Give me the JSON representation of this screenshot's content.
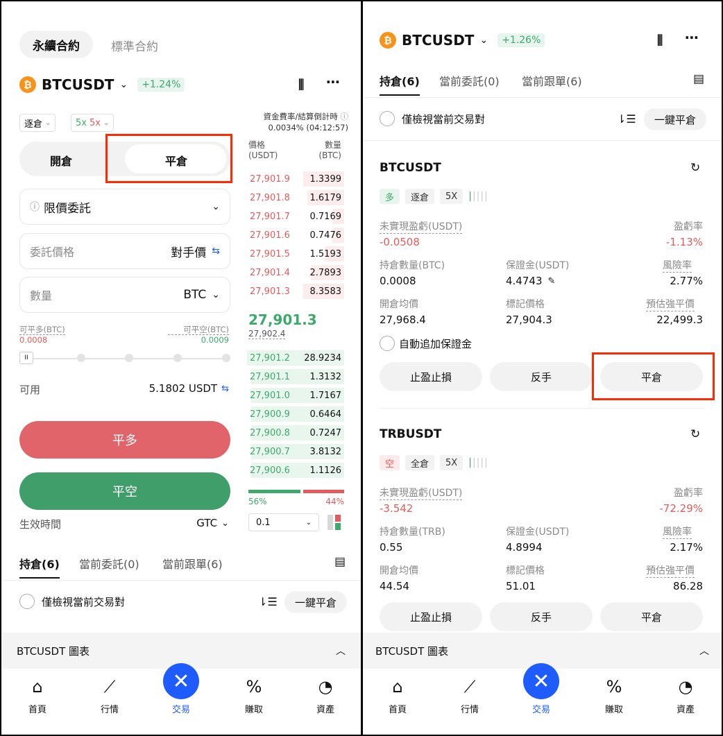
{
  "left": {
    "contract_tabs": [
      "永續合約",
      "標準合約"
    ],
    "symbol": "BTCUSDT",
    "change": "+1.24%",
    "margin_mode": "逐倉",
    "leverage_long": "5x",
    "leverage_short": "5x",
    "funding_label": "資金費率/結算倒計時",
    "funding_value": "0.0034% (04:12:57)",
    "open_close_tabs": [
      "開倉",
      "平倉"
    ],
    "order_type": "限價委託",
    "price_placeholder": "委託價格",
    "price_counter": "對手價",
    "qty_placeholder": "數量",
    "qty_unit": "BTC",
    "close_long_label": "可平多(BTC)",
    "close_long_value": "0.0008",
    "close_short_label": "可平空(BTC)",
    "close_short_value": "0.0009",
    "slider_handle": "II",
    "available_label": "可用",
    "available_value": "5.1802 USDT",
    "close_long_btn": "平多",
    "close_short_btn": "平空",
    "tif_label": "生效時間",
    "tif_value": "GTC",
    "ob_header_price": "價格",
    "ob_header_price_unit": "(USDT)",
    "ob_header_qty": "數量",
    "ob_header_qty_unit": "(BTC)",
    "asks": [
      {
        "p": "27,901.9",
        "q": "1.3399",
        "w": 0.42
      },
      {
        "p": "27,901.8",
        "q": "1.6179",
        "w": 0.38
      },
      {
        "p": "27,901.7",
        "q": "0.7169",
        "w": 0.12
      },
      {
        "p": "27,901.6",
        "q": "0.7476",
        "w": 0.12
      },
      {
        "p": "27,901.5",
        "q": "1.5193",
        "w": 0.2
      },
      {
        "p": "27,901.4",
        "q": "2.7893",
        "w": 0.34
      },
      {
        "p": "27,901.3",
        "q": "8.3583",
        "w": 0.42
      }
    ],
    "mid_price": "27,901.3",
    "mark_price": "27,902.4",
    "bids": [
      {
        "p": "27,901.2",
        "q": "28.9234",
        "w": 1.0
      },
      {
        "p": "27,901.1",
        "q": "1.3132",
        "w": 0.96
      },
      {
        "p": "27,901.0",
        "q": "1.7167",
        "w": 0.96
      },
      {
        "p": "27,900.9",
        "q": "0.6464",
        "w": 0.96
      },
      {
        "p": "27,900.8",
        "q": "0.7247",
        "w": 0.96
      },
      {
        "p": "27,900.7",
        "q": "3.8132",
        "w": 0.96
      },
      {
        "p": "27,900.6",
        "q": "1.1126",
        "w": 0.96
      }
    ],
    "buy_pct": "56%",
    "sell_pct": "44%",
    "buy_ratio": 0.56,
    "precision": "0.1",
    "bottom_tabs": [
      "持倉(6)",
      "當前委託(0)",
      "當前跟單(6)"
    ],
    "only_current": "僅檢視當前交易對",
    "close_all": "一鍵平倉",
    "chart_bar": "BTCUSDT 圖表"
  },
  "right": {
    "symbol": "BTCUSDT",
    "change": "+1.26%",
    "tabs": [
      "持倉(6)",
      "當前委託(0)",
      "當前跟單(6)"
    ],
    "only_current": "僅檢視當前交易對",
    "close_all": "一鍵平倉",
    "positions": [
      {
        "symbol": "BTCUSDT",
        "side": "多",
        "mode": "逐倉",
        "lev": "5X",
        "upl_label": "未實現盈虧(USDT)",
        "upl": "-0.0508",
        "roe_label": "盈虧率",
        "roe": "-1.13%",
        "size_label": "持倉數量(BTC)",
        "size": "0.0008",
        "margin_label": "保證金(USDT)",
        "margin": "4.4743",
        "risk_label": "風險率",
        "risk": "2.77%",
        "entry_label": "開倉均價",
        "entry": "27,968.4",
        "mark_label": "標記價格",
        "mark": "27,904.3",
        "liq_label": "預估強平價",
        "liq": "22,499.3",
        "auto_margin": "自動追加保證金",
        "btn_tpsl": "止盈止損",
        "btn_reverse": "反手",
        "btn_close": "平倉"
      },
      {
        "symbol": "TRBUSDT",
        "side": "空",
        "mode": "全倉",
        "lev": "5X",
        "upl_label": "未實現盈虧(USDT)",
        "upl": "-3.542",
        "roe_label": "盈虧率",
        "roe": "-72.29%",
        "size_label": "持倉數量(TRB)",
        "size": "0.55",
        "margin_label": "保證金(USDT)",
        "margin": "4.8994",
        "risk_label": "風險率",
        "risk": "2.17%",
        "entry_label": "開倉均價",
        "entry": "44.54",
        "mark_label": "標記價格",
        "mark": "51.01",
        "liq_label": "預估強平價",
        "liq": "86.28",
        "btn_tpsl": "止盈止損",
        "btn_reverse": "反手",
        "btn_close": "平倉"
      }
    ],
    "chart_bar": "BTCUSDT 圖表"
  },
  "nav": [
    "首頁",
    "行情",
    "交易",
    "賺取",
    "資產"
  ],
  "colors": {
    "red": "#e55a5a",
    "green": "#3caa6a",
    "accent": "#1f5cff",
    "highlight": "#ff2a00"
  }
}
